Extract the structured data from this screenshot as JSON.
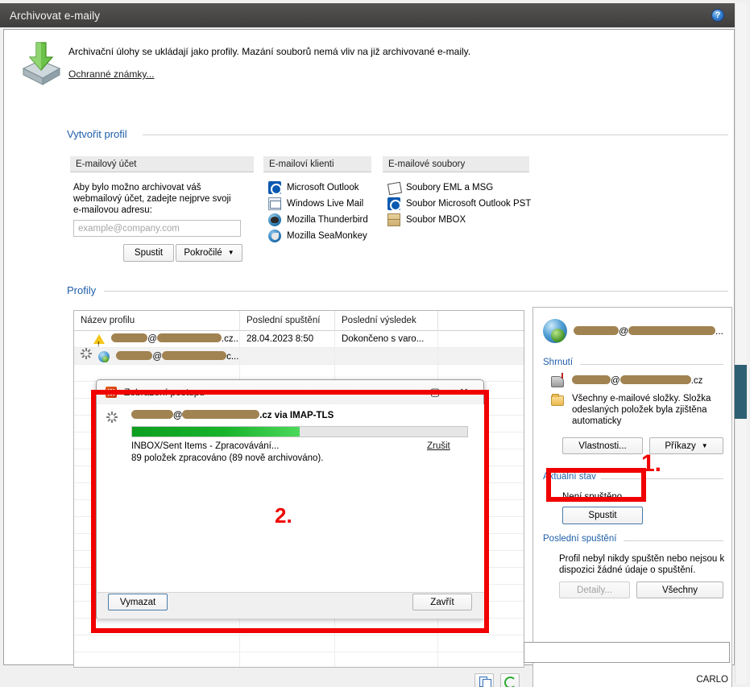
{
  "window": {
    "title": "Archivovat e-maily",
    "help_icon": "help-question-icon",
    "status_bar_text": "CARLO"
  },
  "intro": {
    "icon": "archive-download-icon",
    "text": "Archivační úlohy se ukládají jako profily. Mazání souborů nemá vliv na již archivované e-maily.",
    "link": "Ochranné známky..."
  },
  "create_profile": {
    "heading": "Vytvořit profil",
    "account_column": {
      "header": "E-mailový účet",
      "description_line1": "Aby bylo možno archivovat váš",
      "description_line2": "webmailový účet, zadejte nejprve svoji",
      "description_line3": "e-mailovou adresu:",
      "input_value": "",
      "input_placeholder": "example@company.com",
      "run_button": "Spustit",
      "advanced_button": "Pokročilé",
      "advanced_caret": "▼"
    },
    "clients_column": {
      "header": "E-mailoví klienti",
      "items": [
        {
          "label": "Microsoft Outlook",
          "icon": "outlook-icon"
        },
        {
          "label": "Windows Live Mail",
          "icon": "windows-live-mail-icon"
        },
        {
          "label": "Mozilla Thunderbird",
          "icon": "thunderbird-icon"
        },
        {
          "label": "Mozilla SeaMonkey",
          "icon": "seamonkey-icon"
        }
      ]
    },
    "files_column": {
      "header": "E-mailové soubory",
      "items": [
        {
          "label": "Soubory EML a MSG",
          "icon": "eml-file-icon"
        },
        {
          "label": "Soubor Microsoft Outlook PST",
          "icon": "outlook-pst-icon"
        },
        {
          "label": "Soubor MBOX",
          "icon": "mbox-file-icon"
        }
      ]
    }
  },
  "profiles": {
    "heading": "Profily",
    "columns": [
      "Název profilu",
      "Poslední spuštění",
      "Poslední výsledek",
      ""
    ],
    "rows": [
      {
        "status_icon": "warning-icon",
        "name_prefix_redacted": true,
        "name_at": "@",
        "name_suffix": ".cz...",
        "last_run": "28.04.2023 8:50",
        "last_result": "Dokončeno s varo...",
        "selected": false
      },
      {
        "status_icon": "spinner-icon",
        "type_icon": "globe-download-icon",
        "name_prefix_redacted": true,
        "name_at": "@",
        "name_suffix": "c...",
        "last_run": "",
        "last_result": "",
        "selected": true
      }
    ],
    "toolbar": {
      "copy_icon": "copy-icon",
      "refresh_icon": "refresh-icon"
    }
  },
  "detail_pane": {
    "account_icon": "globe-download-icon",
    "account_at": "@",
    "account_suffix": "...",
    "summary": {
      "heading": "Shrnutí",
      "mailbox_icon": "mailbox-icon",
      "mailbox_at": "@",
      "mailbox_suffix": ".cz",
      "folder_icon": "folder-icon",
      "folder_line1": "Všechny e-mailové složky. Složka",
      "folder_line2": "odeslaných položek byla zjištěna",
      "folder_line3": "automaticky",
      "properties_button": "Vlastnosti...",
      "commands_button": "Příkazy",
      "commands_caret": "▼"
    },
    "current_state": {
      "heading": "Aktuální stav",
      "status": "Není spuštěno",
      "run_button": "Spustit"
    },
    "last_run": {
      "heading": "Poslední spuštění",
      "text_line1": "Profil nebyl nikdy spuštěn nebo nejsou k",
      "text_line2": "dispozici žádné údaje o spuštění.",
      "details_button": "Detaily...",
      "all_button": "Všechny"
    }
  },
  "progress_dialog": {
    "app_icon": "app-icon",
    "title": "Zobrazení postupu",
    "minimize": "—",
    "maximize": "▢",
    "close": "✕",
    "task": {
      "spinner_icon": "spinner-icon",
      "account_at": "@",
      "account_suffix": ".cz via IMAP-TLS",
      "progress_percent": 50,
      "progress_color": "#18b32b",
      "status_line": "INBOX/Sent Items - Zpracovávání...",
      "counts_line": "89 položek zpracováno (89 nově archivováno).",
      "cancel_link": "Zrušit"
    },
    "clear_button": "Vymazat",
    "close_button": "Zavřít"
  },
  "annotations": {
    "marker_1": "1.",
    "marker_2": "2.",
    "color": "#f10000"
  }
}
